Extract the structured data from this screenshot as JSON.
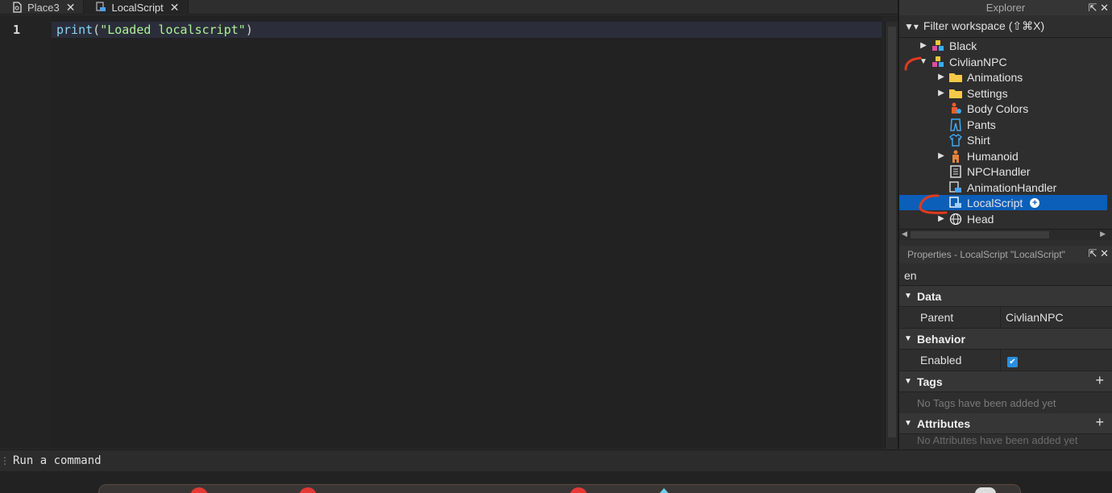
{
  "tabs": [
    {
      "label": "Place3",
      "icon": "document-icon",
      "active": false
    },
    {
      "label": "LocalScript",
      "icon": "local-script-icon",
      "active": true
    }
  ],
  "editor": {
    "line_number": "1",
    "code": {
      "fn": "print",
      "open": "(",
      "string": "\"Loaded localscript\"",
      "close": ")"
    }
  },
  "explorer": {
    "title": "Explorer",
    "filter_placeholder": "Filter workspace (⇧⌘X)",
    "items": [
      {
        "label": "Black",
        "icon": "model-icon",
        "indent": 0,
        "expander": "collapsed"
      },
      {
        "label": "CivlianNPC",
        "icon": "model-icon",
        "indent": 0,
        "expander": "expanded"
      },
      {
        "label": "Animations",
        "icon": "folder-icon",
        "indent": 1,
        "expander": "collapsed"
      },
      {
        "label": "Settings",
        "icon": "folder-icon",
        "indent": 1,
        "expander": "collapsed"
      },
      {
        "label": "Body Colors",
        "icon": "body-colors-icon",
        "indent": 1,
        "expander": "none"
      },
      {
        "label": "Pants",
        "icon": "pants-icon",
        "indent": 1,
        "expander": "none"
      },
      {
        "label": "Shirt",
        "icon": "shirt-icon",
        "indent": 1,
        "expander": "none"
      },
      {
        "label": "Humanoid",
        "icon": "humanoid-icon",
        "indent": 1,
        "expander": "collapsed"
      },
      {
        "label": "NPCHandler",
        "icon": "script-icon",
        "indent": 1,
        "expander": "none"
      },
      {
        "label": "AnimationHandler",
        "icon": "local-script-icon",
        "indent": 1,
        "expander": "none"
      },
      {
        "label": "LocalScript",
        "icon": "local-script-icon",
        "indent": 1,
        "expander": "none",
        "selected": true
      },
      {
        "label": "Head",
        "icon": "globe-icon",
        "indent": 1,
        "expander": "collapsed"
      }
    ]
  },
  "properties": {
    "title": "Properties - LocalScript \"LocalScript\"",
    "filter_value": "en",
    "sections": {
      "data": "Data",
      "behavior": "Behavior",
      "tags": "Tags",
      "attributes": "Attributes"
    },
    "parent_label": "Parent",
    "parent_value": "CivlianNPC",
    "enabled_label": "Enabled",
    "enabled_checked": true,
    "tags_note": "No Tags have been added yet",
    "attributes_note": "No Attributes have been added yet"
  },
  "command_bar": {
    "placeholder": "Run a command"
  },
  "colors": {
    "accent": "#0b5fb9",
    "string": "#adf195",
    "keyword": "#84d6f7"
  }
}
